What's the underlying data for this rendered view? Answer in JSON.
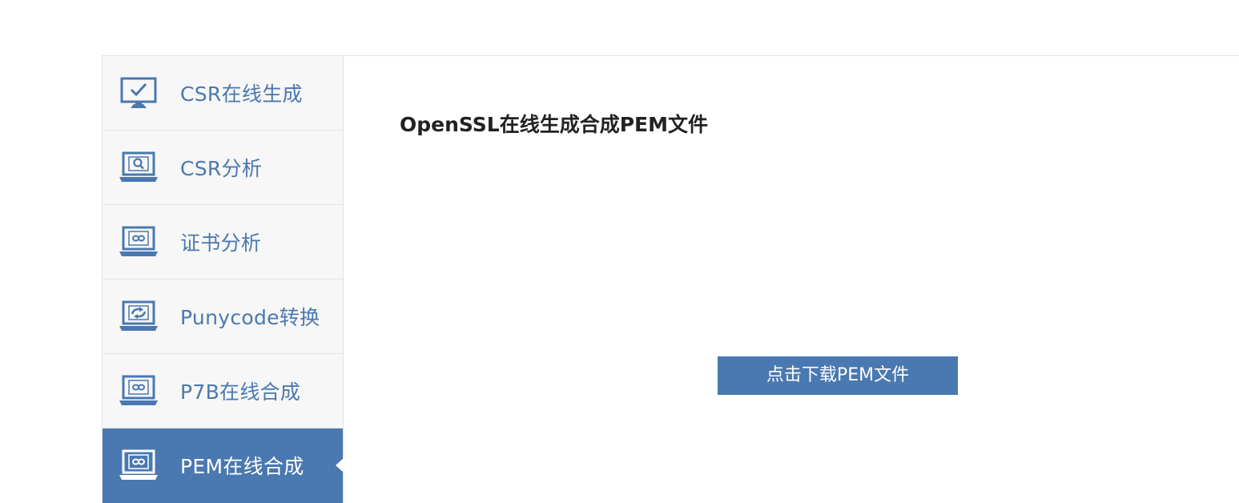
{
  "page": {
    "title": "OpenSSL在线生成合成PEM文件",
    "download_button": "点击下载PEM文件"
  },
  "sidebar": {
    "items": [
      {
        "label": "CSR在线生成",
        "icon": "monitor-check-icon"
      },
      {
        "label": "CSR分析",
        "icon": "laptop-search-icon"
      },
      {
        "label": "证书分析",
        "icon": "laptop-link-icon"
      },
      {
        "label": "Punycode转换",
        "icon": "laptop-convert-icon"
      },
      {
        "label": "P7B在线合成",
        "icon": "laptop-link-icon"
      },
      {
        "label": "PEM在线合成",
        "icon": "laptop-link-icon",
        "active": true
      }
    ]
  },
  "colors": {
    "accent": "#4a78b0",
    "sidebar_bg": "#f7f7f7",
    "border": "#e3e3e3"
  }
}
